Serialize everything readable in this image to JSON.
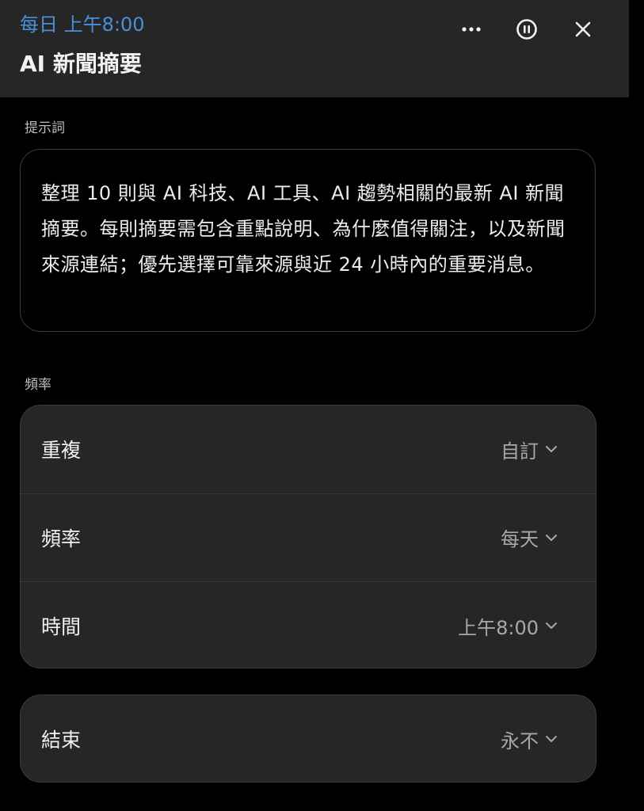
{
  "header": {
    "schedule": "每日 上午8:00",
    "title": "AI 新聞摘要",
    "icons": [
      "more-horizontal-icon",
      "pause-circle-icon",
      "close-icon"
    ],
    "accent_color": "#4a90d9"
  },
  "prompt": {
    "label": "提示詞",
    "text": "整理 10 則與 AI 科技、AI 工具、AI 趨勢相關的最新 AI 新聞摘要。每則摘要需包含重點說明、為什麼值得關注，以及新聞來源連結；優先選擇可靠來源與近 24 小時內的重要消息。"
  },
  "frequency": {
    "label": "頻率",
    "rows": [
      {
        "label": "重複",
        "value": "自訂"
      },
      {
        "label": "頻率",
        "value": "每天"
      },
      {
        "label": "時間",
        "value": "上午8:00"
      }
    ]
  },
  "end": {
    "label": "結束",
    "value": "永不"
  }
}
